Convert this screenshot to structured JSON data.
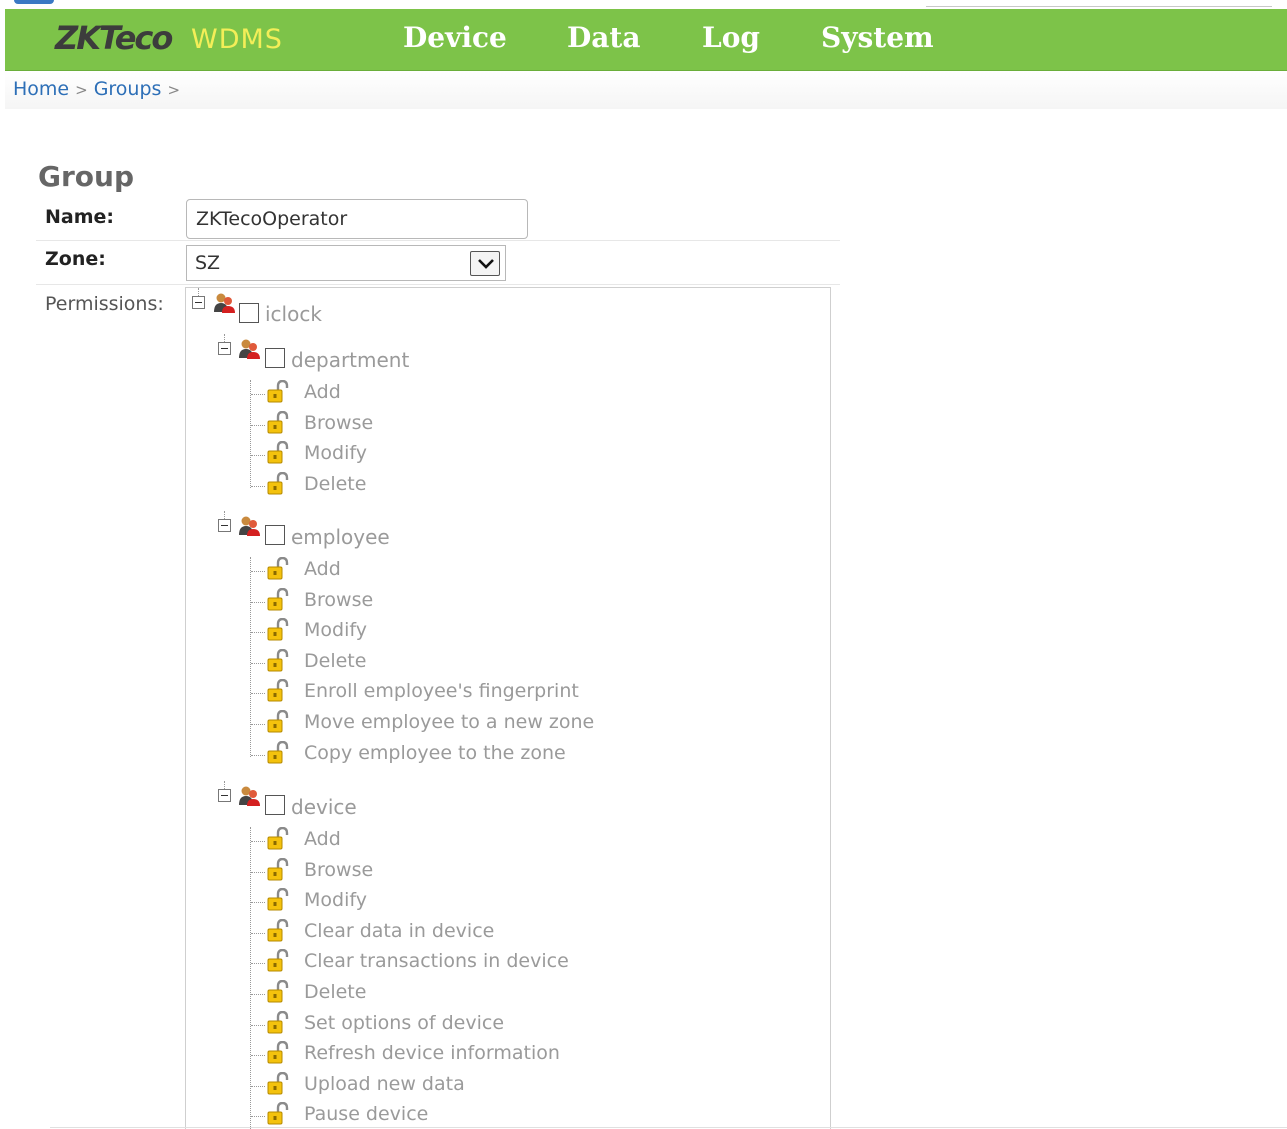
{
  "header": {
    "logo": "ZKTeco",
    "app_name": "WDMS",
    "nav": [
      "Device",
      "Data",
      "Log",
      "System"
    ]
  },
  "breadcrumb": [
    "Home",
    "Groups"
  ],
  "form": {
    "title": "Group",
    "name_label": "Name:",
    "name_value": "ZKTecoOperator",
    "zone_label": "Zone:",
    "zone_value": "SZ",
    "permissions_label": "Permissions:"
  },
  "permissions": {
    "root": "iclock",
    "groups": [
      {
        "name": "department",
        "items": [
          "Add",
          "Browse",
          "Modify",
          "Delete"
        ]
      },
      {
        "name": "employee",
        "items": [
          "Add",
          "Browse",
          "Modify",
          "Delete",
          "Enroll employee's fingerprint",
          "Move employee to a new zone",
          "Copy employee to the zone"
        ]
      },
      {
        "name": "device",
        "items": [
          "Add",
          "Browse",
          "Modify",
          "Clear data in device",
          "Clear transactions in device",
          "Delete",
          "Set options of device",
          "Refresh device information",
          "Upload new data",
          "Pause device"
        ]
      }
    ]
  },
  "colors": {
    "navbar": "#7dc349",
    "app_name": "#f3ee58",
    "link": "#2d6fb7",
    "tree_text": "#9a9a9a"
  },
  "icons": {
    "group": "users-group-icon",
    "permission": "padlock-icon",
    "expander": "tree-collapse-icon",
    "dropdown": "chevron-down-icon"
  }
}
